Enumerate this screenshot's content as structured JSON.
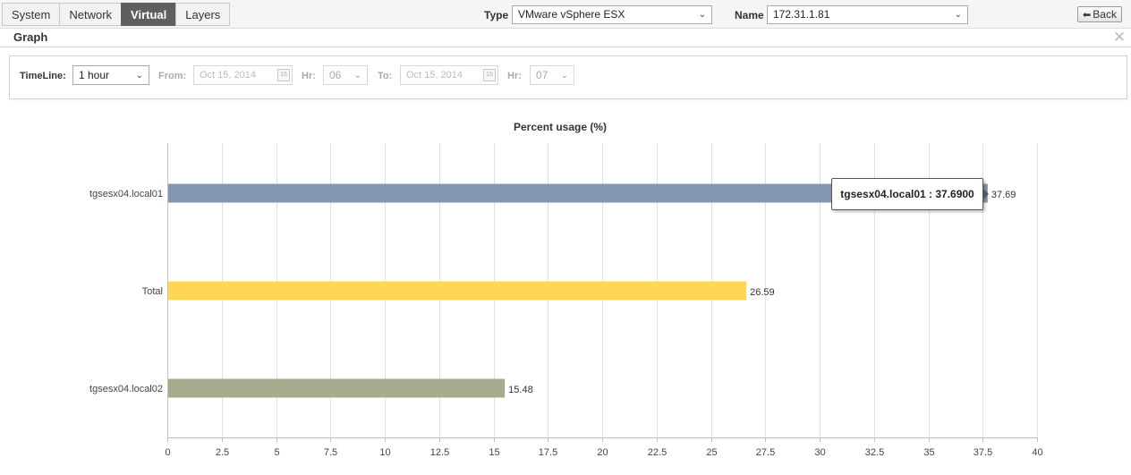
{
  "tabs": [
    {
      "label": "System",
      "active": false
    },
    {
      "label": "Network",
      "active": false
    },
    {
      "label": "Virtual",
      "active": true
    },
    {
      "label": "Layers",
      "active": false
    }
  ],
  "type_filter": {
    "label": "Type",
    "value": "VMware vSphere ESX"
  },
  "name_filter": {
    "label": "Name",
    "value": "172.31.1.81"
  },
  "back_button": {
    "label": "Back"
  },
  "graph_panel": {
    "title": "Graph"
  },
  "timeline": {
    "label": "TimeLine:",
    "range": "1 hour",
    "from_label": "From:",
    "from_date": "Oct 15, 2014",
    "from_hr_label": "Hr:",
    "from_hr": "06",
    "to_label": "To:",
    "to_date": "Oct 15, 2014",
    "to_hr_label": "Hr:",
    "to_hr": "07"
  },
  "tooltip": {
    "text": "tgsesx04.local01 : 37.6900"
  },
  "icons": {
    "back": "back-arrow-icon",
    "close": "close-icon",
    "dropdown": "chevron-down-icon",
    "calendar": "calendar-icon"
  },
  "chart_data": {
    "type": "bar",
    "orientation": "horizontal",
    "title": "Percent usage (%)",
    "categories": [
      "tgsesx04.local01",
      "Total",
      "tgsesx04.local02"
    ],
    "values": [
      37.69,
      26.59,
      15.48
    ],
    "value_labels": [
      "37.69",
      "26.59",
      "15.48"
    ],
    "colors": [
      "#8497b0",
      "#ffd755",
      "#a7ab8d"
    ],
    "xlim": [
      0,
      40
    ],
    "xticks": [
      "0",
      "2.5",
      "5",
      "7.5",
      "10",
      "12.5",
      "15",
      "17.5",
      "20",
      "22.5",
      "25",
      "27.5",
      "30",
      "32.5",
      "35",
      "37.5",
      "40"
    ],
    "grid": true,
    "legend": "none"
  }
}
